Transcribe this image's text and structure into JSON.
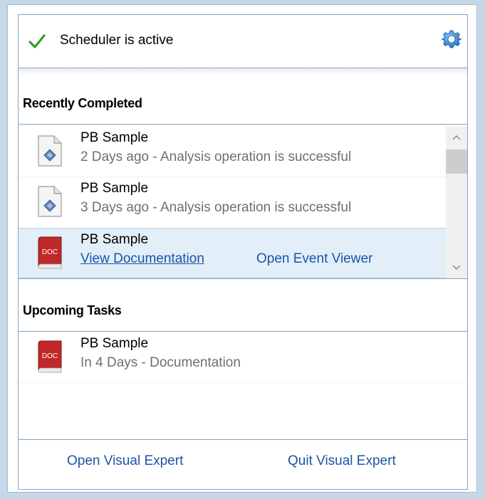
{
  "status": {
    "text": "Scheduler is active",
    "icon": "check-icon",
    "settings_icon": "gear-icon",
    "accent_color": "#2e9e2e"
  },
  "recently_completed": {
    "header": "Recently Completed",
    "items": [
      {
        "name": "PB Sample",
        "detail": "2 Days ago -  Analysis operation is successful",
        "icon": "document-file-icon"
      },
      {
        "name": "PB Sample",
        "detail": "3 Days ago -  Analysis operation is successful",
        "icon": "document-file-icon"
      },
      {
        "name": "PB Sample",
        "icon": "doc-book-icon",
        "links": {
          "view_documentation": "View Documentation",
          "open_event_viewer": "Open Event Viewer"
        }
      }
    ]
  },
  "upcoming_tasks": {
    "header": "Upcoming Tasks",
    "items": [
      {
        "name": "PB Sample",
        "detail": "In 4 Days - Documentation",
        "icon": "doc-book-icon"
      }
    ]
  },
  "footer": {
    "open_label": "Open Visual Expert",
    "quit_label": "Quit Visual Expert"
  },
  "book_badge": "DOC"
}
